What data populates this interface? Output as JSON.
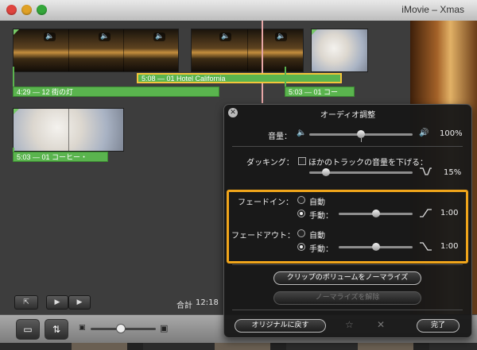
{
  "window": {
    "title": "iMovie – Xmas",
    "traffic_colors": [
      "#e0443e",
      "#e0a125",
      "#34a73a"
    ]
  },
  "project": {
    "clips": [
      {
        "label": "4:29 — 12 街の灯"
      },
      {
        "label": "5:08 — 01 Hotel California"
      },
      {
        "label": "5:03 — 01 コー"
      },
      {
        "label": "5:03 — 01 コーヒー・"
      }
    ],
    "total_label": "合計",
    "total_value": "12:18"
  },
  "hud": {
    "title": "オーディオ調整",
    "volume": {
      "label": "音量：",
      "value": "100%",
      "level": 0.5
    },
    "ducking": {
      "label": "ダッキング：",
      "checkbox_label": "ほかのトラックの音量を下げる：",
      "value": "15%",
      "level": 0.15,
      "checked": false
    },
    "fade_in": {
      "label": "フェードイン：",
      "auto": "自動",
      "manual": "手動：",
      "value": "1:00",
      "selected": "manual"
    },
    "fade_out": {
      "label": "フェードアウト：",
      "auto": "自動",
      "manual": "手動：",
      "value": "1:00",
      "selected": "manual"
    },
    "normalize_button": "クリップのボリュームをノーマライズ",
    "remove_normalize_button": "ノーマライズを解除",
    "revert_button": "オリジナルに戻す",
    "done_button": "完了",
    "highlight_color": "#f0a51b"
  }
}
